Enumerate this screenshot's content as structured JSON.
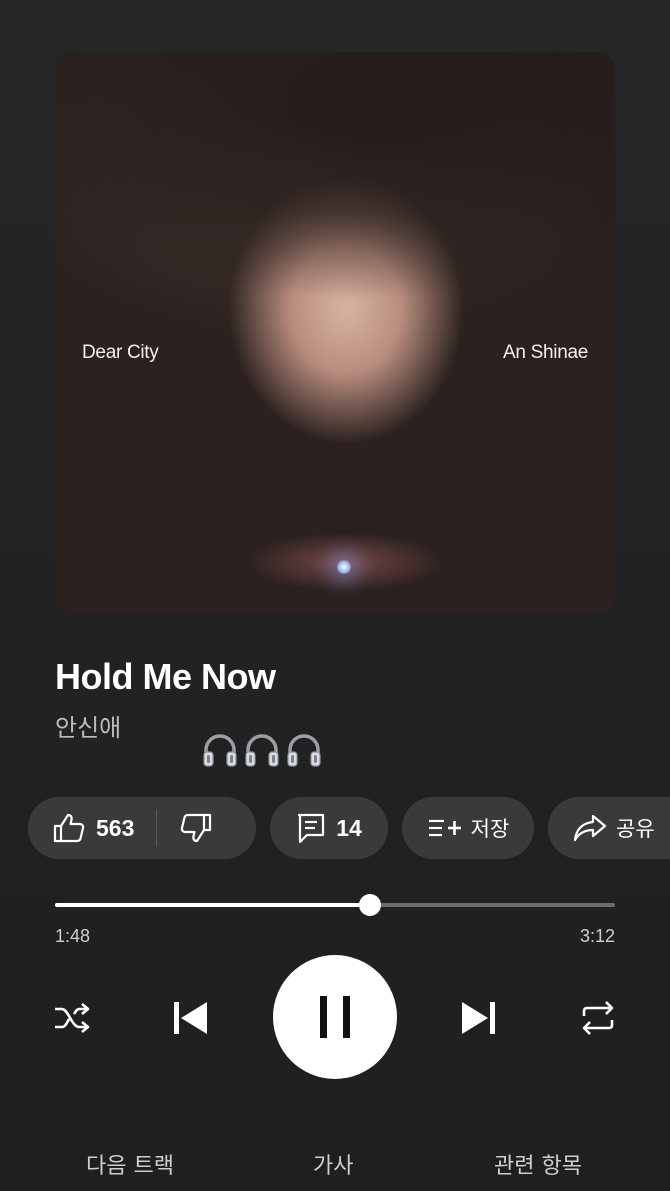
{
  "album_art": {
    "left_text": "Dear City",
    "right_text": "An Shinae"
  },
  "song": {
    "title": "Hold Me Now",
    "artist": "안신애"
  },
  "headphone_icons": [
    "headphones-icon",
    "headphones-icon",
    "headphones-icon"
  ],
  "actions": {
    "like_count": "563",
    "comment_count": "14",
    "save_label": "저장",
    "share_label": "공유"
  },
  "progress": {
    "current": "1:48",
    "total": "3:12",
    "fraction": 0.5625
  },
  "tabs": {
    "up_next": "다음 트랙",
    "lyrics": "가사",
    "related": "관련 항목"
  },
  "colors": {
    "background": "#242424",
    "chip": "#3a3a3a",
    "accent": "#ffffff"
  }
}
